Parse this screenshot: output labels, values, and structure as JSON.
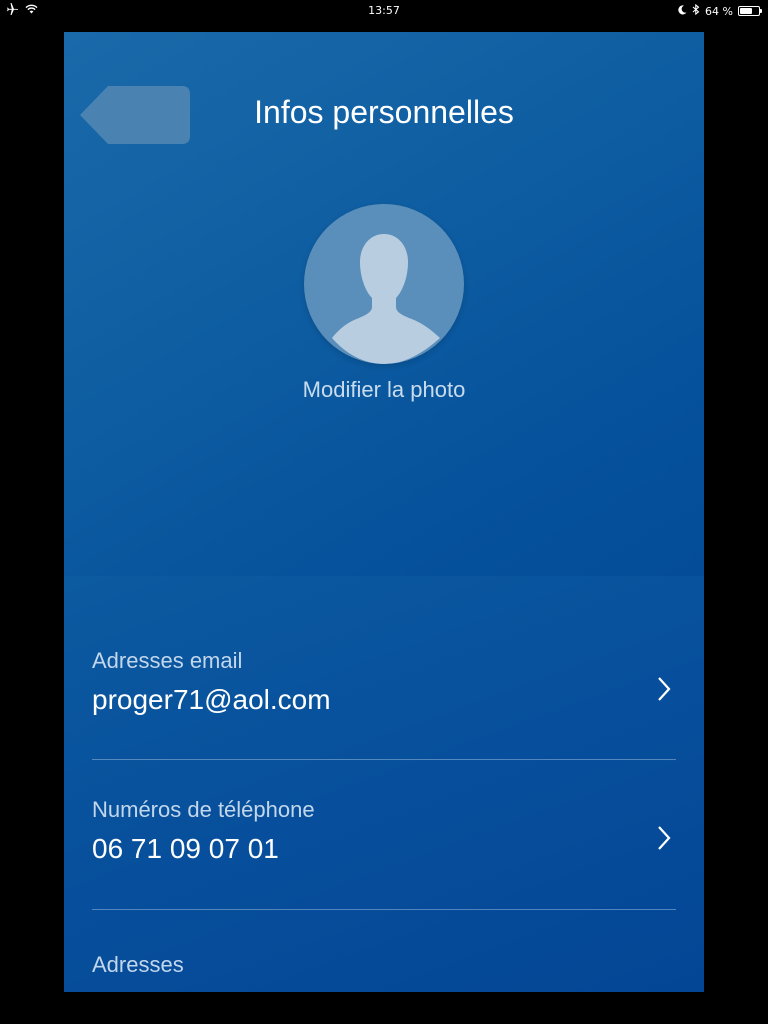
{
  "status_bar": {
    "time": "13:57",
    "battery": "64 %",
    "battery_level": 0.64
  },
  "header": {
    "title": "Infos personnelles",
    "back_label": ""
  },
  "profile": {
    "modify_photo_label": "Modifier la photo"
  },
  "list": {
    "items": [
      {
        "label": "Adresses email",
        "value": "proger71@aol.com"
      },
      {
        "label": "Numéros de téléphone",
        "value": "06 71 09 07 01"
      },
      {
        "label": "Adresses",
        "value": ""
      }
    ]
  },
  "icons": {
    "back": "back-arrow-icon",
    "avatar": "user-silhouette-icon",
    "chevron": "chevron-right-icon",
    "airplane": "airplane-icon",
    "wifi": "wifi-icon",
    "moon": "moon-icon",
    "bluetooth": "bluetooth-icon",
    "battery": "battery-icon"
  },
  "colors": {
    "background": "#0550a0",
    "header_bg": "#1565a8",
    "label_text": "#c3d7ec",
    "value_text": "#ffffff",
    "back_button": "#4a82b2"
  }
}
